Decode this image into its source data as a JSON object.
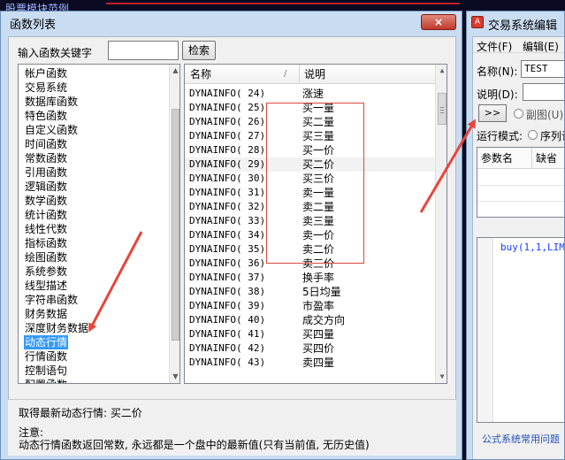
{
  "background": {
    "title": "股票模块范例"
  },
  "dialog": {
    "title": "函数列表",
    "close_glyph": "×",
    "search": {
      "label": "输入函数关键字",
      "value": "",
      "button": "检索"
    },
    "categories": [
      {
        "label": "帐户函数",
        "selected": false
      },
      {
        "label": "交易系统",
        "selected": false
      },
      {
        "label": "数据库函数",
        "selected": false
      },
      {
        "label": "特色函数",
        "selected": false
      },
      {
        "label": "自定义函数",
        "selected": false
      },
      {
        "label": "时间函数",
        "selected": false
      },
      {
        "label": "常数函数",
        "selected": false
      },
      {
        "label": "引用函数",
        "selected": false
      },
      {
        "label": "逻辑函数",
        "selected": false
      },
      {
        "label": "数学函数",
        "selected": false
      },
      {
        "label": "统计函数",
        "selected": false
      },
      {
        "label": "线性代数",
        "selected": false
      },
      {
        "label": "指标函数",
        "selected": false
      },
      {
        "label": "绘图函数",
        "selected": false
      },
      {
        "label": "系统参数",
        "selected": false
      },
      {
        "label": "线型描述",
        "selected": false
      },
      {
        "label": "字符串函数",
        "selected": false
      },
      {
        "label": "财务数据",
        "selected": false
      },
      {
        "label": "深度财务数据",
        "selected": false
      },
      {
        "label": "动态行情",
        "selected": true
      },
      {
        "label": "行情函数",
        "selected": false
      },
      {
        "label": "控制语句",
        "selected": false
      },
      {
        "label": "配置函数",
        "selected": false
      }
    ],
    "table": {
      "col_name": "名称",
      "col_sort": "/",
      "col_desc": "说明",
      "rows": [
        {
          "name": "DYNAINFO( 24)",
          "desc": "涨速"
        },
        {
          "name": "DYNAINFO( 25)",
          "desc": "买一量"
        },
        {
          "name": "DYNAINFO( 26)",
          "desc": "买二量"
        },
        {
          "name": "DYNAINFO( 27)",
          "desc": "买三量"
        },
        {
          "name": "DYNAINFO( 28)",
          "desc": "买一价"
        },
        {
          "name": "DYNAINFO( 29)",
          "desc": "买二价"
        },
        {
          "name": "DYNAINFO( 30)",
          "desc": "买三价"
        },
        {
          "name": "DYNAINFO( 31)",
          "desc": "卖一量"
        },
        {
          "name": "DYNAINFO( 32)",
          "desc": "卖二量"
        },
        {
          "name": "DYNAINFO( 33)",
          "desc": "卖三量"
        },
        {
          "name": "DYNAINFO( 34)",
          "desc": "卖一价"
        },
        {
          "name": "DYNAINFO( 35)",
          "desc": "卖二价"
        },
        {
          "name": "DYNAINFO( 36)",
          "desc": "卖三价"
        },
        {
          "name": "DYNAINFO( 37)",
          "desc": "换手率"
        },
        {
          "name": "DYNAINFO( 38)",
          "desc": "5日均量"
        },
        {
          "name": "DYNAINFO( 39)",
          "desc": "市盈率"
        },
        {
          "name": "DYNAINFO( 40)",
          "desc": "成交方向"
        },
        {
          "name": "DYNAINFO( 41)",
          "desc": "买四量"
        },
        {
          "name": "DYNAINFO( 42)",
          "desc": "买四价"
        },
        {
          "name": "DYNAINFO( 43)",
          "desc": "卖四量"
        }
      ]
    },
    "info": {
      "line1": "取得最新动态行情: 买二价",
      "line2": "注意:",
      "line3": "动态行情函数返回常数, 永远都是一个盘中的最新值(只有当前值, 无历史值)"
    }
  },
  "right_window": {
    "title": "交易系统编辑",
    "icon_glyph": "A",
    "menu": {
      "file": "文件(F)",
      "edit": "编辑(E)"
    },
    "name_label": "名称(N):",
    "name_value": "TEST",
    "desc_label": "说明(D):",
    "desc_value": "",
    "expand_button": ">>",
    "subchart_label": "副图(U)",
    "mode_label": "运行模式:",
    "mode_option": "序列计",
    "grid": {
      "col_param": "参数名",
      "col_default": "缺省"
    },
    "code": "buy(1,1,LIM",
    "footer": "公式系统常用问题"
  },
  "colors": {
    "title_bar": "#c9dcf1",
    "selection": "#3399ff",
    "annotation_red": "#d9463c",
    "code_blue": "#1a3cff"
  }
}
